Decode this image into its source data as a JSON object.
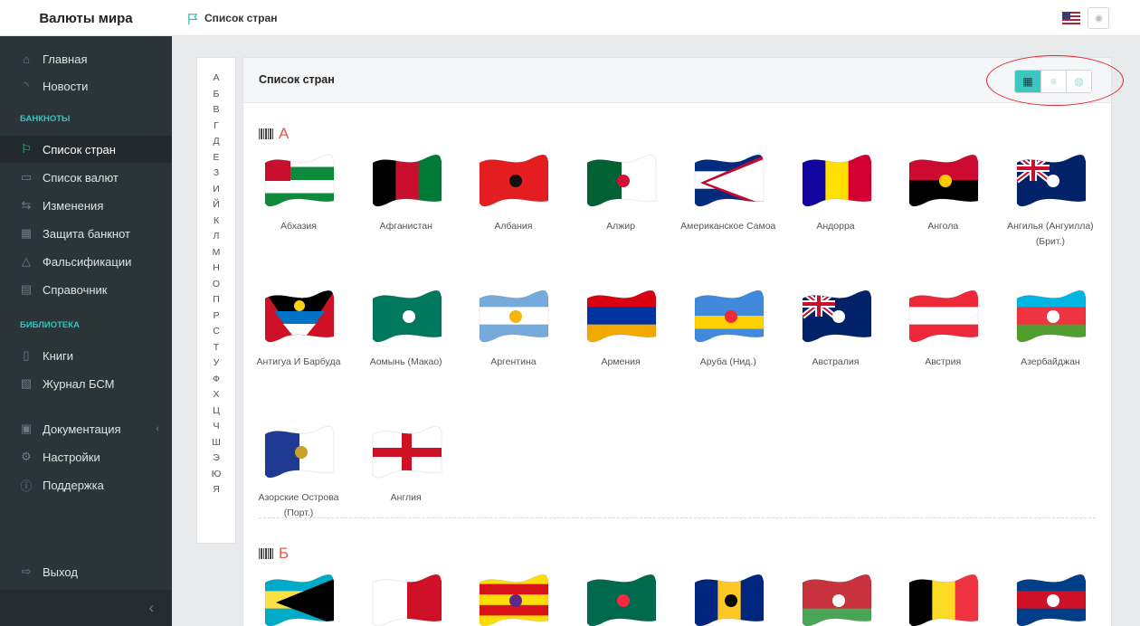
{
  "app": {
    "title": "Валюты мира"
  },
  "breadcrumb": {
    "label": "Список стран"
  },
  "sidebar": {
    "items": [
      {
        "name": "home",
        "label": "Главная",
        "icon": "home-icon"
      },
      {
        "name": "news",
        "label": "Новости",
        "icon": "rss-icon"
      }
    ],
    "section_banknotes": "БАНКНОТЫ",
    "banknotes": [
      {
        "name": "countries",
        "label": "Список стран",
        "icon": "flag-icon",
        "active": true
      },
      {
        "name": "currencies",
        "label": "Список валют",
        "icon": "money-icon"
      },
      {
        "name": "changes",
        "label": "Изменения",
        "icon": "exchange-icon"
      },
      {
        "name": "protection",
        "label": "Защита банкнот",
        "icon": "grid-icon"
      },
      {
        "name": "fakes",
        "label": "Фальсификации",
        "icon": "warning-icon"
      },
      {
        "name": "reference",
        "label": "Справочник",
        "icon": "document-icon"
      }
    ],
    "section_library": "БИБЛИОТЕКА",
    "library": [
      {
        "name": "books",
        "label": "Книги",
        "icon": "book-icon"
      },
      {
        "name": "journal",
        "label": "Журнал БСМ",
        "icon": "pdf-icon"
      }
    ],
    "other": [
      {
        "name": "docs",
        "label": "Документация",
        "icon": "archive-icon"
      },
      {
        "name": "settings",
        "label": "Настройки",
        "icon": "gear-icon"
      },
      {
        "name": "support",
        "label": "Поддержка",
        "icon": "info-icon"
      }
    ],
    "logout": "Выход",
    "collapse_glyph": "‹"
  },
  "alphabet": [
    "А",
    "Б",
    "В",
    "Г",
    "Д",
    "Е",
    "З",
    "И",
    "Й",
    "К",
    "Л",
    "М",
    "Н",
    "О",
    "П",
    "Р",
    "С",
    "Т",
    "У",
    "Ф",
    "Х",
    "Ц",
    "Ч",
    "Ш",
    "Э",
    "Ю",
    "Я"
  ],
  "panel": {
    "title": "Список стран",
    "view_buttons": [
      {
        "name": "grid-view-button",
        "glyph": "▦",
        "active": true
      },
      {
        "name": "list-view-button",
        "glyph": "≡"
      },
      {
        "name": "globe-view-button",
        "glyph": "◍"
      }
    ]
  },
  "sections": [
    {
      "letter": "А",
      "countries": [
        {
          "name": "Абхазия",
          "flag": [
            "#ffffff",
            "#0e8a3d",
            "#ffffff",
            "#0e8a3d"
          ],
          "canton": "#c8102e"
        },
        {
          "name": "Афганистан",
          "flag": [
            "#000000",
            "#c8102e",
            "#007a36"
          ],
          "vertical": true
        },
        {
          "name": "Албания",
          "flag": [
            "#e41e20",
            "#e41e20"
          ],
          "emblem": "#111111"
        },
        {
          "name": "Алжир",
          "flag": [
            "#006233",
            "#ffffff"
          ],
          "vertical": true,
          "emblem": "#d21034"
        },
        {
          "name": "Американское Самоа",
          "flag": [
            "#002b7f",
            "#ffffff",
            "#002b7f"
          ],
          "triangle": "#ffffff",
          "triangleEdge": "#bf0a30"
        },
        {
          "name": "Андорра",
          "flag": [
            "#10069f",
            "#fedf00",
            "#d50032"
          ],
          "vertical": true
        },
        {
          "name": "Ангола",
          "flag": [
            "#cc092f",
            "#000000"
          ],
          "emblem": "#ffcb00"
        },
        {
          "name": "Ангилья (Ангуилла) (Брит.)",
          "flag": [
            "#012169",
            "#012169"
          ],
          "canton": "#012169",
          "union": true,
          "emblem": "#ffffff"
        },
        {
          "name": "Антигуа И Барбуда",
          "flag": [
            "#000000",
            "#0072c6",
            "#ffffff"
          ],
          "antigua": true
        },
        {
          "name": "Аомынь (Макао)",
          "flag": [
            "#00785e",
            "#00785e"
          ],
          "emblem": "#ffffff"
        },
        {
          "name": "Аргентина",
          "flag": [
            "#75aadb",
            "#ffffff",
            "#75aadb"
          ],
          "emblem": "#f6b40e"
        },
        {
          "name": "Армения",
          "flag": [
            "#d90012",
            "#0033a0",
            "#f2a800"
          ]
        },
        {
          "name": "Аруба (Нид.)",
          "flag": [
            "#4189dd",
            "#4189dd",
            "#ffd100",
            "#4189dd"
          ],
          "emblem": "#ee2a35"
        },
        {
          "name": "Австралия",
          "flag": [
            "#012169",
            "#012169"
          ],
          "union": true,
          "emblem": "#ffffff"
        },
        {
          "name": "Австрия",
          "flag": [
            "#ed2939",
            "#ffffff",
            "#ed2939"
          ]
        },
        {
          "name": "Азербайджан",
          "flag": [
            "#00b5e2",
            "#ef3340",
            "#509e2f"
          ],
          "emblem": "#ffffff"
        },
        {
          "name": "Азорские Острова (Порт.)",
          "flag": [
            "#1f3a93",
            "#ffffff"
          ],
          "vertical": true,
          "emblem": "#c9a227"
        },
        {
          "name": "Англия",
          "flag": [
            "#ffffff",
            "#ffffff"
          ],
          "england": true
        }
      ]
    },
    {
      "letter": "Б",
      "countries": [
        {
          "name": "",
          "flag": [
            "#00abc9",
            "#fae042",
            "#00abc9"
          ],
          "triangle": "#000000"
        },
        {
          "name": "",
          "flag": [
            "#ffffff",
            "#ce1126"
          ],
          "vertical": true
        },
        {
          "name": "",
          "flag": [
            "#fcdd09",
            "#da121a",
            "#fcdd09",
            "#da121a",
            "#fcdd09"
          ],
          "emblem": "#5b2a86"
        },
        {
          "name": "",
          "flag": [
            "#006a4e",
            "#006a4e"
          ],
          "emblem": "#f42a41"
        },
        {
          "name": "",
          "flag": [
            "#00267f",
            "#ffc726",
            "#00267f"
          ],
          "vertical": true,
          "emblem": "#000000"
        },
        {
          "name": "",
          "flag": [
            "#c8313e",
            "#c8313e",
            "#4aa657"
          ],
          "emblem": "#ffffff"
        },
        {
          "name": "",
          "flag": [
            "#000000",
            "#fdda24",
            "#ef3340"
          ],
          "vertical": true
        },
        {
          "name": "",
          "flag": [
            "#003f87",
            "#ce1126",
            "#003f87"
          ],
          "emblem": "#ffffff"
        }
      ]
    }
  ]
}
